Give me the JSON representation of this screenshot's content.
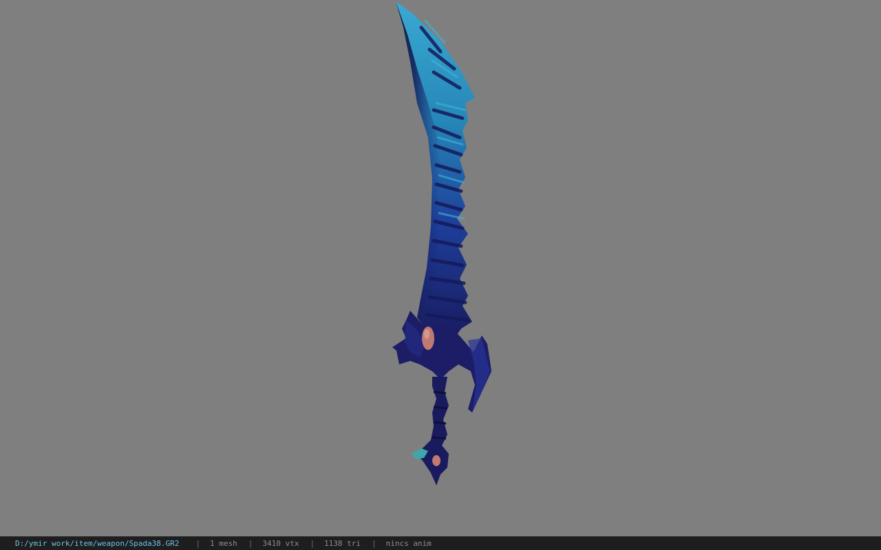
{
  "viewer": {
    "background_color": "#808080",
    "model_icon": "sword-model"
  },
  "status": {
    "file_path": "D:/ymir work/item/weapon/Spada38.GR2",
    "separator": "|",
    "mesh_count": "1 mesh",
    "vertex_count": "3410 vtx",
    "triangle_count": "1138 tri",
    "anim_status": "nincs anim"
  },
  "colors": {
    "path_text": "#6fc0e8",
    "status_bg": "#1e1e1e",
    "blade_light": "#2e9fc8",
    "blade_dark": "#1b1f6e"
  }
}
